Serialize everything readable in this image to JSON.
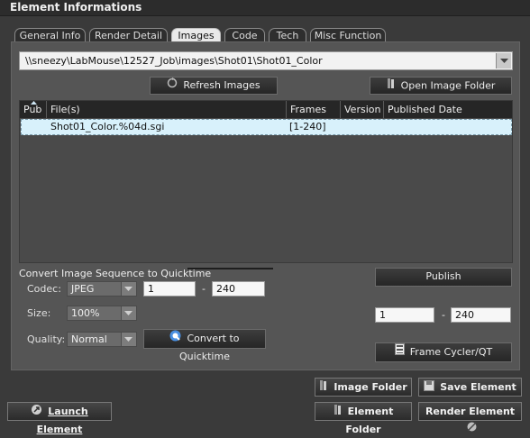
{
  "window": {
    "title": "Element Informations"
  },
  "tabs": [
    {
      "label": "General Info",
      "active": false
    },
    {
      "label": "Render Detail",
      "active": false
    },
    {
      "label": "Images",
      "active": true
    },
    {
      "label": "Code",
      "active": false
    },
    {
      "label": "Tech",
      "active": false
    },
    {
      "label": "Misc Function",
      "active": false
    }
  ],
  "images": {
    "path": "\\\\sneezy\\LabMouse\\12527_Job\\images\\Shot01\\Shot01_Color",
    "refresh_label": "Refresh Images",
    "open_folder_label": "Open Image Folder",
    "table": {
      "columns": [
        "Pub",
        "File(s)",
        "Frames",
        "Version",
        "Published Date"
      ],
      "rows": [
        {
          "pub": "",
          "file": "Shot01_Color.%04d.sgi",
          "frames": "[1-240]",
          "version": "",
          "published_date": ""
        }
      ]
    }
  },
  "quicktime": {
    "section_title": "Convert Image Sequence to Quicktime",
    "codec_label": "Codec:",
    "codec_value": "JPEG",
    "start_frame": "1",
    "end_frame": "240",
    "size_label": "Size:",
    "size_value": "100%",
    "quality_label": "Quality:",
    "quality_value": "Normal",
    "convert_label": "Convert to Quicktime",
    "dash": "-"
  },
  "publish": {
    "publish_label": "Publish",
    "start_frame": "1",
    "end_frame": "240",
    "frame_cycler_label": "Frame Cycler/QT",
    "dash": "-"
  },
  "footer": {
    "launch_label": "Launch Element",
    "image_folder_label": "Image Folder",
    "save_element_label": "Save Element",
    "element_folder_label": "Element Folder",
    "render_element_label": "Render Element"
  },
  "colors": {
    "background": "#3a3a3a",
    "panel": "#555555",
    "selected_row": "#d8f1fb",
    "active_tab": "#e9e9e9"
  }
}
